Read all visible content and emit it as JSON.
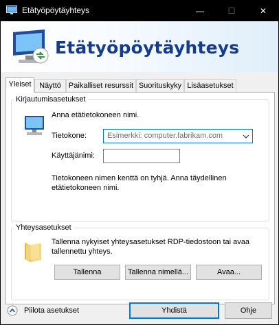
{
  "window": {
    "title": "Etätyöpöytäyhteys",
    "minimize_glyph": "—",
    "maximize_glyph": "☐",
    "close_glyph": "✕"
  },
  "header": {
    "title": "Etätyöpöytäyhteys",
    "icon": "remote-desktop-icon"
  },
  "tabs": [
    {
      "label": "Yleiset",
      "active": true
    },
    {
      "label": "Näyttö",
      "active": false
    },
    {
      "label": "Paikalliset resurssit",
      "active": false
    },
    {
      "label": "Suorituskyky",
      "active": false
    },
    {
      "label": "Lisäasetukset",
      "active": false
    }
  ],
  "login": {
    "legend": "Kirjautumisasetukset",
    "intro": "Anna etätietokoneen nimi.",
    "computer_label": "Tietokone:",
    "computer_placeholder": "Esimerkki: computer.fabrikam.com",
    "computer_value": "",
    "username_label": "Käyttäjänimi:",
    "username_value": "",
    "hint": "Tietokoneen nimen kenttä on tyhjä. Anna täydellinen etätietokoneen nimi."
  },
  "connection": {
    "legend": "Yhteysasetukset",
    "description": "Tallenna nykyiset yhteysasetukset RDP-tiedostoon tai avaa tallennettu yhteys.",
    "save_label": "Tallenna",
    "save_as_label": "Tallenna nimellä...",
    "open_label": "Avaa..."
  },
  "footer": {
    "hide_options_label": "Piilota asetukset",
    "connect_label": "Yhdistä",
    "help_label": "Ohje"
  },
  "colors": {
    "title_blue": "#143c8c",
    "focus_blue": "#0078d7",
    "window_bg": "#f0f0f0"
  }
}
